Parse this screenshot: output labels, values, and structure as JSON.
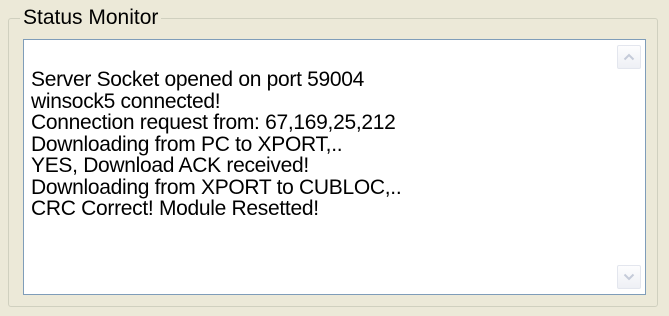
{
  "group": {
    "title": "Status Monitor"
  },
  "log": {
    "lines": [
      "Server Socket opened on port 59004",
      "winsock5 connected!",
      "Connection request from: 67,169,25,212",
      "Downloading from PC to XPORT,..",
      "YES, Download ACK received!",
      "Downloading from XPORT to CUBLOC,..",
      "CRC Correct! Module Resetted!"
    ]
  },
  "icons": {
    "scroll_up": "chevron-up-icon",
    "scroll_down": "chevron-down-icon"
  },
  "colors": {
    "window_bg": "#ece9d8",
    "textarea_border": "#7f9db9",
    "scroll_arrow": "#c5cbd9"
  }
}
